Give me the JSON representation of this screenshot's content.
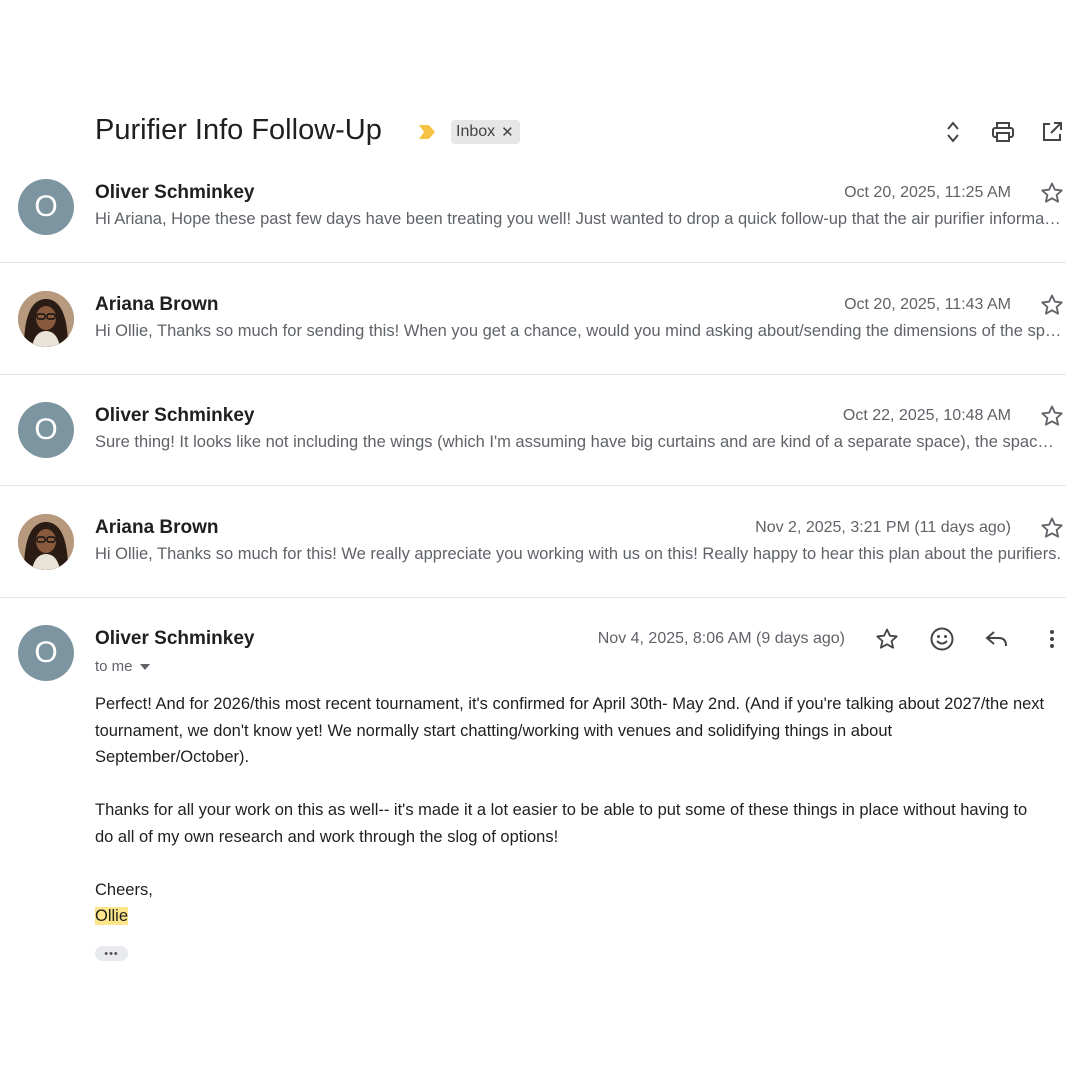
{
  "thread": {
    "subject": "Purifier Info Follow-Up",
    "label": "Inbox",
    "header_icons": [
      "expand-collapse-icon",
      "print-icon",
      "open-in-new-window-icon"
    ]
  },
  "messages": [
    {
      "sender": "Oliver Schminkey",
      "avatar_letter": "O",
      "date": "Oct 20, 2025, 11:25 AM",
      "snippet": "Hi Ariana, Hope these past few days have been treating you well! Just wanted to drop a quick follow-up that the air purifier information is attached here."
    },
    {
      "sender": "Ariana Brown",
      "avatar_letter": "",
      "date": "Oct 20, 2025, 11:43 AM",
      "snippet": "Hi Ollie, Thanks so much for sending this! When you get a chance, would you mind asking about/sending the dimensions of the space?"
    },
    {
      "sender": "Oliver Schminkey",
      "avatar_letter": "O",
      "date": "Oct 22, 2025, 10:48 AM",
      "snippet": "Sure thing! It looks like not including the wings (which I'm assuming have big curtains and are kind of a separate space), the space is roughly"
    },
    {
      "sender": "Ariana Brown",
      "avatar_letter": "",
      "date": "Nov 2, 2025, 3:21 PM (11 days ago)",
      "snippet": "Hi Ollie, Thanks so much for this! We really appreciate you working with us on this! Really happy to hear this plan about the purifiers."
    }
  ],
  "open_message": {
    "sender": "Oliver Schminkey",
    "avatar_letter": "O",
    "date": "Nov 4, 2025, 8:06 AM (9 days ago)",
    "recipient": "to me",
    "paragraph1": "Perfect! And for 2026/this most recent tournament, it's confirmed for April 30th- May 2nd. (And if you're talking about 2027/the next tournament, we don't know yet! We normally start chatting/working with venues and solidifying things in about September/October).",
    "paragraph2": "Thanks for all your work on this as well-- it's made it a lot easier to be able to put some of these things in place without having to do all of my own research and work through the slog of options!",
    "signoff": "Cheers,",
    "signature": "Ollie",
    "trimmed_content": "•••"
  },
  "colors": {
    "avatar": "#7d95a0",
    "important_marker": "#f5c444",
    "highlight": "#fde68a"
  }
}
